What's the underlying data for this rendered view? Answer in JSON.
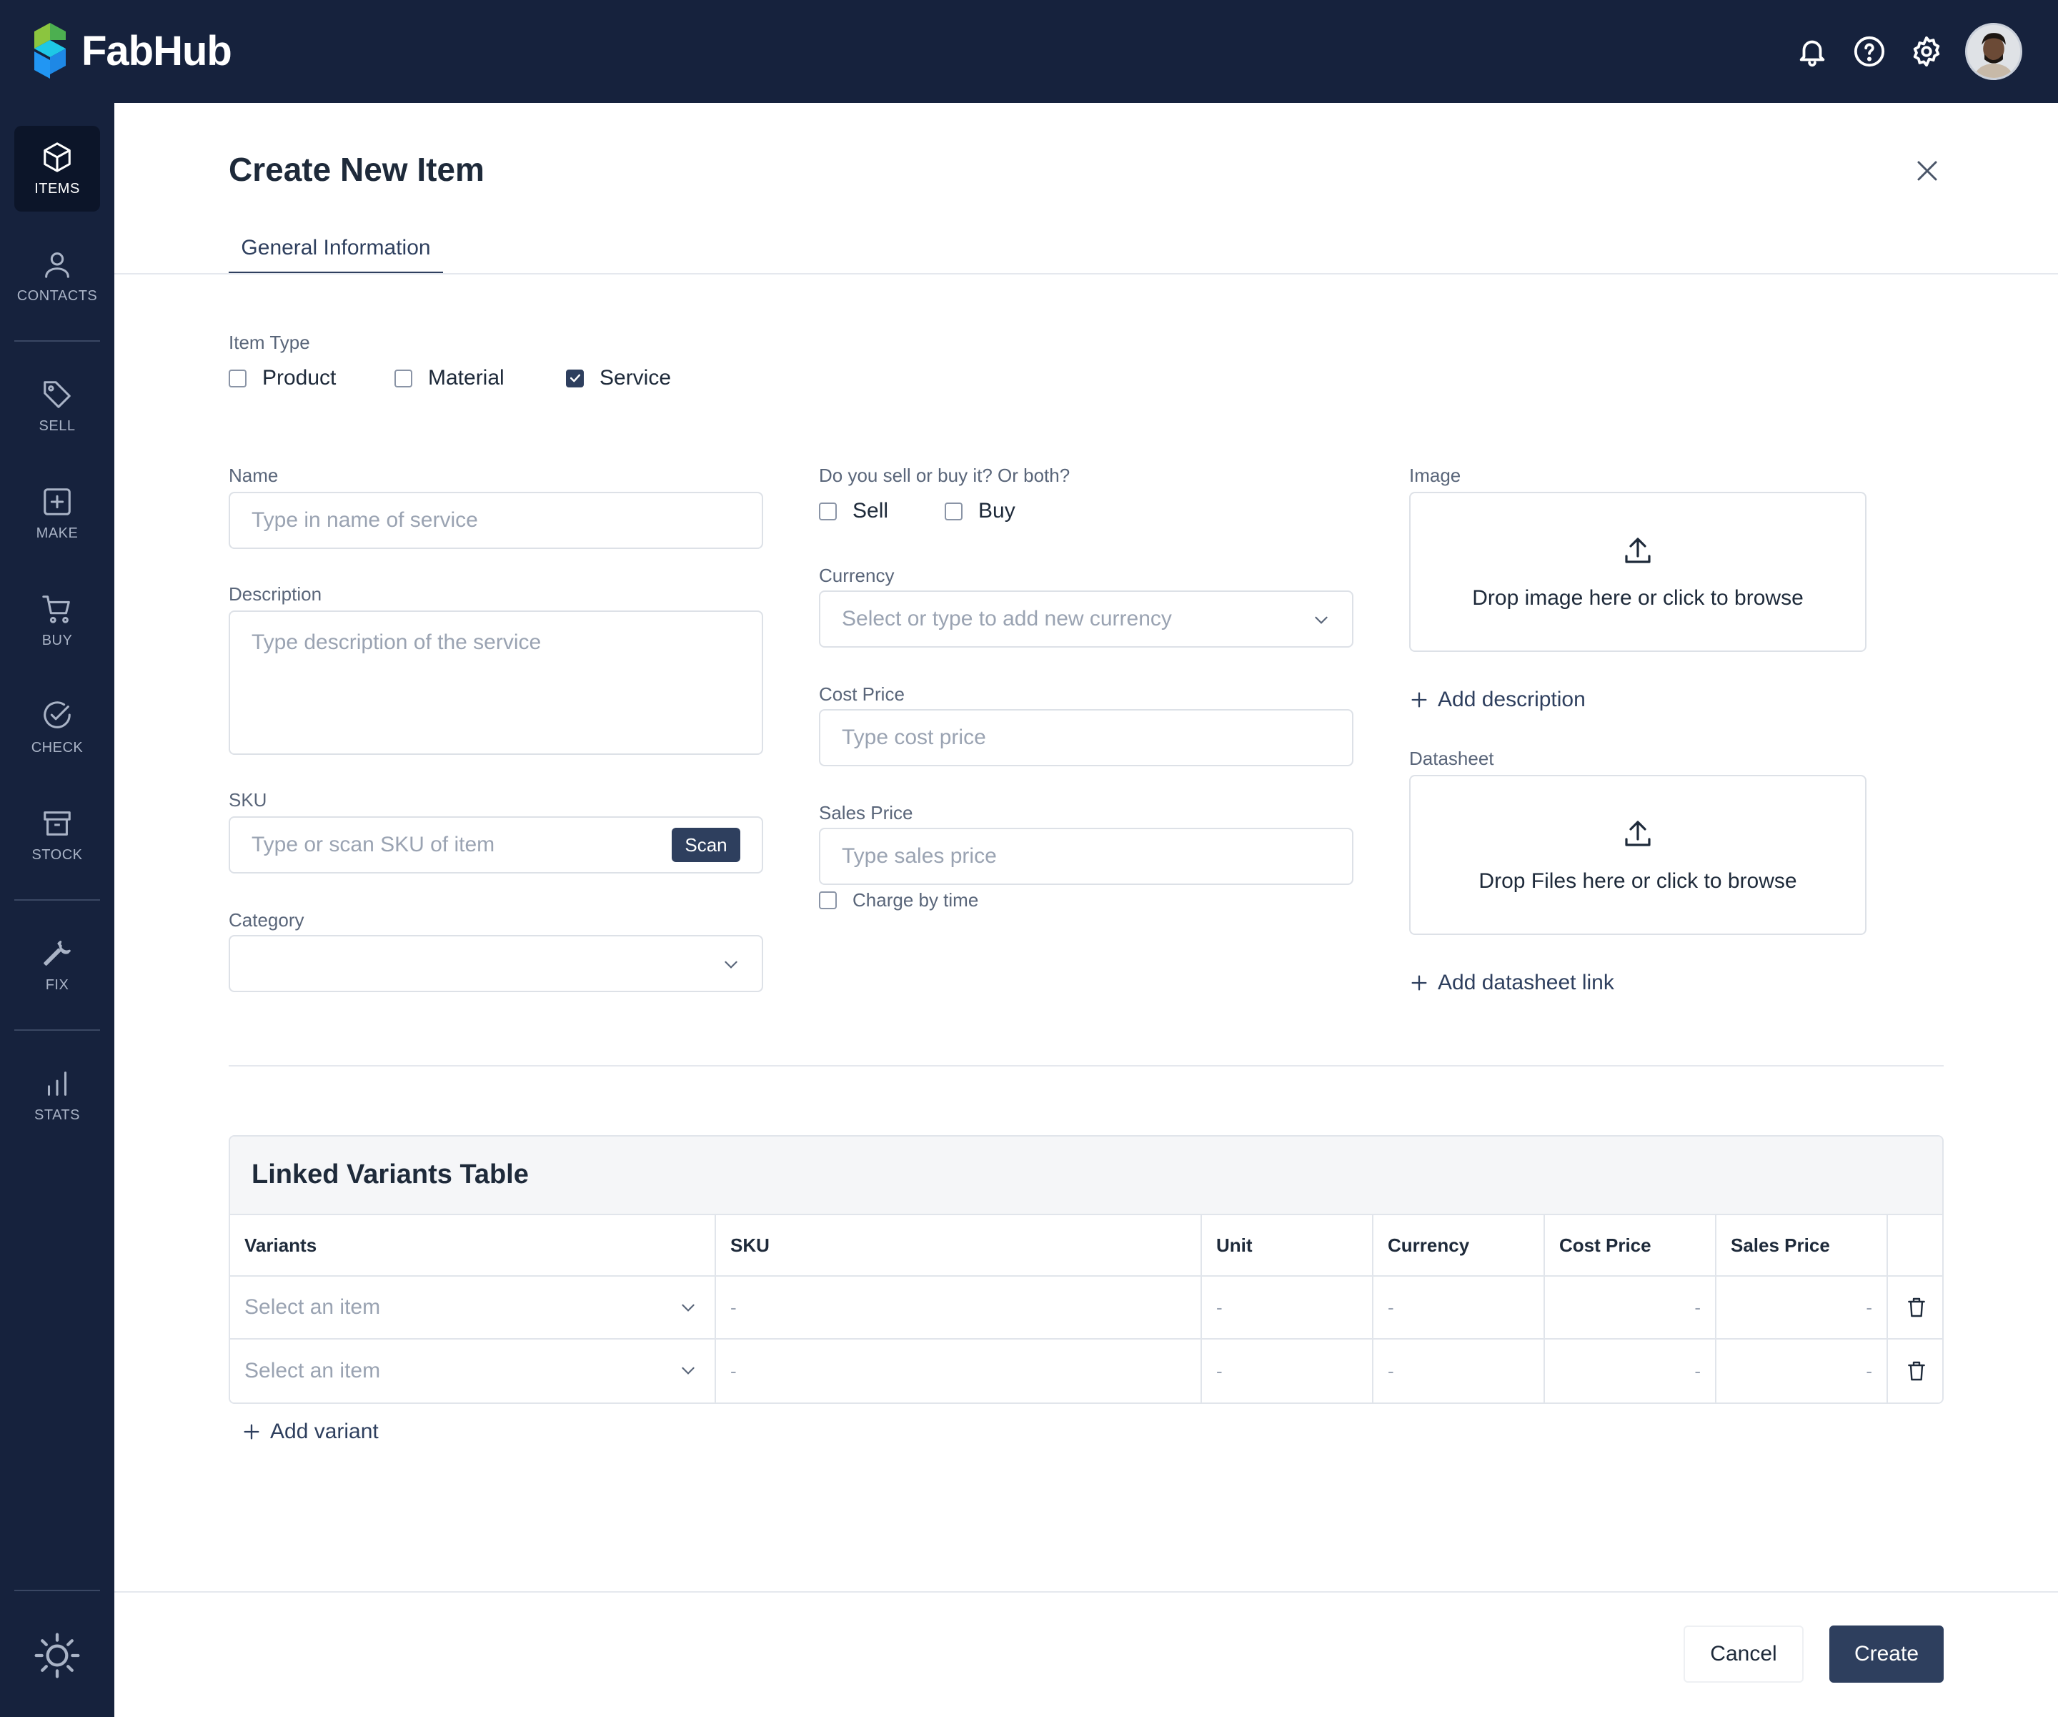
{
  "app": {
    "name": "FabHub"
  },
  "sidebar": {
    "items": [
      {
        "label": "ITEMS",
        "icon": "cube-icon"
      },
      {
        "label": "CONTACTS",
        "icon": "person-icon"
      },
      {
        "label": "SELL",
        "icon": "tag-icon"
      },
      {
        "label": "MAKE",
        "icon": "plus-square-icon"
      },
      {
        "label": "BUY",
        "icon": "cart-icon"
      },
      {
        "label": "CHECK",
        "icon": "check-circle-icon"
      },
      {
        "label": "STOCK",
        "icon": "archive-icon"
      },
      {
        "label": "FIX",
        "icon": "wrench-icon"
      },
      {
        "label": "STATS",
        "icon": "bar-chart-icon"
      }
    ]
  },
  "header": {
    "title": "Create New Item",
    "tab": "General Information"
  },
  "item_type": {
    "label": "Item Type",
    "options": [
      {
        "label": "Product",
        "checked": false
      },
      {
        "label": "Material",
        "checked": false
      },
      {
        "label": "Service",
        "checked": true
      }
    ]
  },
  "form": {
    "name_label": "Name",
    "name_placeholder": "Type in name of service",
    "description_label": "Description",
    "description_placeholder": "Type description of the service",
    "sku_label": "SKU",
    "sku_placeholder": "Type or scan SKU of item",
    "scan_label": "Scan",
    "category_label": "Category",
    "sell_buy_label": "Do you sell or buy it? Or both?",
    "sell_label": "Sell",
    "buy_label": "Buy",
    "currency_label": "Currency",
    "currency_placeholder": "Select or type to add new currency",
    "cost_label": "Cost Price",
    "cost_placeholder": "Type cost price",
    "sales_label": "Sales Price",
    "sales_placeholder": "Type sales price",
    "charge_by_time": "Charge by time",
    "image_label": "Image",
    "image_drop": "Drop image here or click to browse",
    "add_description": "Add description",
    "datasheet_label": "Datasheet",
    "datasheet_drop": "Drop Files here or click to browse",
    "add_datasheet": "Add datasheet link"
  },
  "variants": {
    "title": "Linked Variants Table",
    "columns": [
      "Variants",
      "SKU",
      "Unit",
      "Currency",
      "Cost Price",
      "Sales Price"
    ],
    "rows": [
      {
        "variant": "Select an item",
        "sku": "-",
        "unit": "-",
        "currency": "-",
        "cost": "-",
        "sales": "-"
      },
      {
        "variant": "Select an item",
        "sku": "-",
        "unit": "-",
        "currency": "-",
        "cost": "-",
        "sales": "-"
      }
    ],
    "add_label": "Add variant"
  },
  "footer": {
    "cancel": "Cancel",
    "create": "Create"
  },
  "colors": {
    "nav_bg": "#16223d",
    "accent": "#2e3f5e"
  }
}
